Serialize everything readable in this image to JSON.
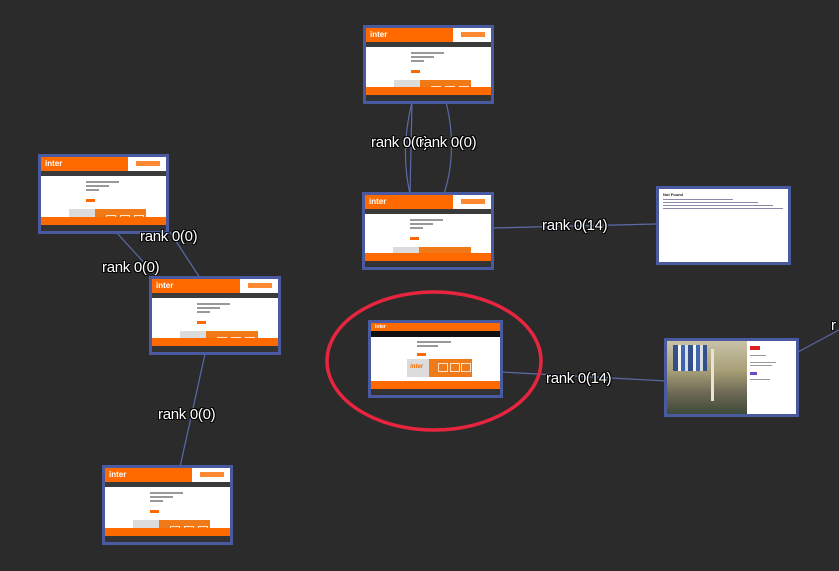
{
  "graph": {
    "selected_node": "node-middle-selected",
    "edge_labels": [
      "rank 0(0)",
      "rank 0(0)",
      "rank 0(14)",
      "rank 0(0)",
      "rank 0(0)",
      "rank 0(0)",
      "rank 0(14)",
      "r"
    ]
  },
  "thumbs": {
    "inter_logo": "inter",
    "inter_small_logo": "inter",
    "text_page_title": "Not Found"
  },
  "colors": {
    "background": "#2b2b2b",
    "edge": "#5b6aa8",
    "node_border": "#4a5aa0",
    "brand_orange": "#ff6a00",
    "highlight": "#e8253f"
  }
}
